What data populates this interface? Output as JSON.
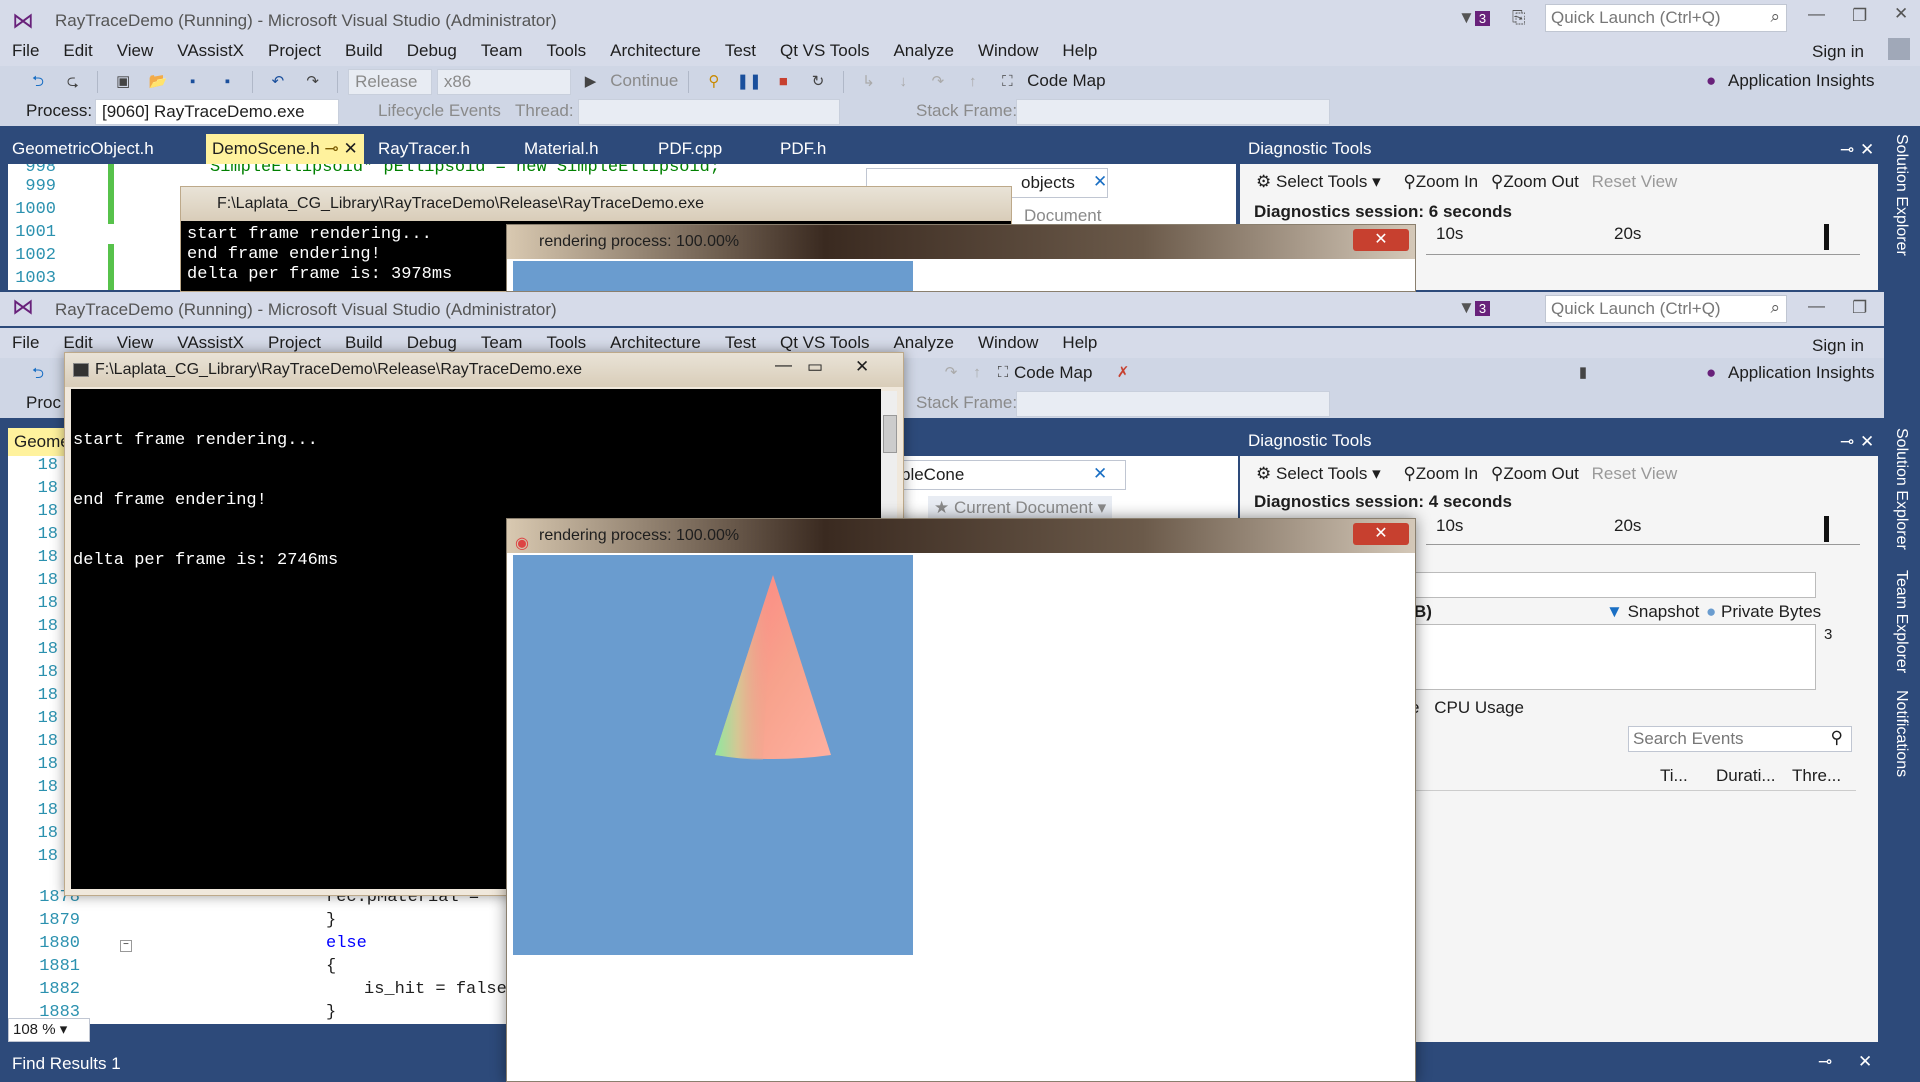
{
  "window": {
    "title": "RayTraceDemo (Running) - Microsoft Visual Studio (Administrator)",
    "notif_count": "3",
    "quick_launch_placeholder": "Quick Launch (Ctrl+Q)",
    "sign_in": "Sign in"
  },
  "menu": [
    "File",
    "Edit",
    "View",
    "VAssistX",
    "Project",
    "Build",
    "Debug",
    "Team",
    "Tools",
    "Architecture",
    "Test",
    "Qt VS Tools",
    "Analyze",
    "Window",
    "Help"
  ],
  "toolbar": {
    "config": "Release",
    "platform": "x86",
    "continue": "Continue",
    "code_map": "Code Map",
    "app_insights": "Application Insights"
  },
  "debug_location": {
    "process_label": "Process:",
    "process_value": "[9060] RayTraceDemo.exe",
    "lifecycle": "Lifecycle Events",
    "thread_label": "Thread:",
    "stack_label": "Stack Frame:"
  },
  "tabs": [
    "GeometricObject.h",
    "DemoScene.h",
    "RayTracer.h",
    "Material.h",
    "PDF.cpp",
    "PDF.h"
  ],
  "tab_active": "DemoScene.h",
  "tab_short": "Geome",
  "back_editor": {
    "code_top": "SimpleEllipsoid* pEllipsoid = new SimpleEllipsoid;",
    "lines": [
      "998",
      "999",
      "1000",
      "1001",
      "1002",
      "1003"
    ]
  },
  "front_editor": {
    "lines_partial": [
      "18",
      "18",
      "18",
      "18",
      "18",
      "18",
      "18",
      "18",
      "18",
      "18",
      "18",
      "18",
      "18",
      "18",
      "18",
      "18",
      "18",
      "18"
    ],
    "lines_full": [
      "1878",
      "1879",
      "1880",
      "1881",
      "1882",
      "1883"
    ],
    "code": [
      "rec.pMaterial =",
      "}",
      "else",
      "{",
      "is_hit = false;",
      "}"
    ],
    "zoom": "108 %"
  },
  "search_box_back": "objects",
  "search_box_front": "pleCone",
  "scope_back": "Document",
  "scope_front": "Current Document",
  "diagnostics": {
    "title": "Diagnostic Tools",
    "select_tools": "Select Tools",
    "zoom_in": "Zoom In",
    "zoom_out": "Zoom Out",
    "reset_view": "Reset View",
    "session_back": "Diagnostics session: 6 seconds",
    "session_front": "Diagnostics session: 4 seconds",
    "tick_10": "10s",
    "tick_20": "20s",
    "mem_label": "B)",
    "snapshot": "Snapshot",
    "private_bytes": "Private Bytes",
    "mem_value": "3",
    "tab_partial": "e",
    "cpu_usage": "CPU Usage",
    "search_events_placeholder": "Search Events",
    "col_time": "Ti...",
    "col_duration": "Durati...",
    "col_thread": "Thre..."
  },
  "side_panels": [
    "Solution Explorer",
    "Team Explorer",
    "Notifications"
  ],
  "console": {
    "title": "F:\\Laplata_CG_Library\\RayTraceDemo\\Release\\RayTraceDemo.exe",
    "back_lines": [
      "start frame rendering...",
      "end frame endering!",
      "delta per frame is: 3978ms"
    ],
    "front_lines": [
      "start frame rendering...",
      "end frame endering!",
      "delta per frame is: 2746ms"
    ]
  },
  "render_window": {
    "title": "rendering process: 100.00%",
    "progress": 100
  },
  "find_results": "Find Results 1",
  "colors": {
    "vs_blue": "#2d4a7a",
    "render_bg": "#6a9ccf",
    "close_red": "#c7402f"
  }
}
